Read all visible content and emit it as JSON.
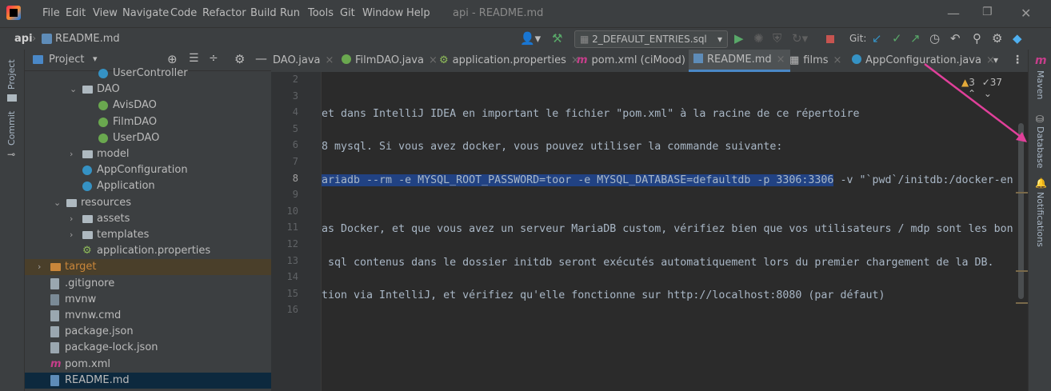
{
  "menu": {
    "items": [
      "File",
      "Edit",
      "View",
      "Navigate",
      "Code",
      "Refactor",
      "Build",
      "Run",
      "Tools",
      "Git",
      "Window",
      "Help"
    ],
    "title": "api - README.md"
  },
  "nav": {
    "project": "api",
    "file": "README.md",
    "run_config": "2_DEFAULT_ENTRIES.sql",
    "git_label": "Git:"
  },
  "project_panel": {
    "title": "Project",
    "tree": [
      {
        "label": "UserController",
        "depth": 4,
        "kind": "class"
      },
      {
        "label": "DAO",
        "depth": 3,
        "kind": "folder",
        "expanded": true
      },
      {
        "label": "AvisDAO",
        "depth": 4,
        "kind": "interface"
      },
      {
        "label": "FilmDAO",
        "depth": 4,
        "kind": "interface"
      },
      {
        "label": "UserDAO",
        "depth": 4,
        "kind": "interface"
      },
      {
        "label": "model",
        "depth": 3,
        "kind": "folder",
        "expanded": false
      },
      {
        "label": "AppConfiguration",
        "depth": 3,
        "kind": "class"
      },
      {
        "label": "Application",
        "depth": 3,
        "kind": "app"
      },
      {
        "label": "resources",
        "depth": 2,
        "kind": "resfolder",
        "expanded": true
      },
      {
        "label": "assets",
        "depth": 3,
        "kind": "folder",
        "expanded": false
      },
      {
        "label": "templates",
        "depth": 3,
        "kind": "folder",
        "expanded": false
      },
      {
        "label": "application.properties",
        "depth": 3,
        "kind": "props"
      },
      {
        "label": "target",
        "depth": 1,
        "kind": "target",
        "expanded": false
      },
      {
        "label": ".gitignore",
        "depth": 1,
        "kind": "file"
      },
      {
        "label": "mvnw",
        "depth": 1,
        "kind": "exec"
      },
      {
        "label": "mvnw.cmd",
        "depth": 1,
        "kind": "file"
      },
      {
        "label": "package.json",
        "depth": 1,
        "kind": "file"
      },
      {
        "label": "package-lock.json",
        "depth": 1,
        "kind": "file"
      },
      {
        "label": "pom.xml",
        "depth": 1,
        "kind": "maven"
      },
      {
        "label": "README.md",
        "depth": 1,
        "kind": "md",
        "selected": true
      }
    ]
  },
  "left_strip": {
    "project": "Project",
    "commit": "Commit"
  },
  "right_strip": {
    "maven": "Maven",
    "database": "Database",
    "notifications": "Notifications"
  },
  "tabs": [
    {
      "label": "DAO.java",
      "icon": ""
    },
    {
      "label": "FilmDAO.java",
      "icon": "interface"
    },
    {
      "label": "application.properties",
      "icon": "props"
    },
    {
      "label": "pom.xml (ciMood)",
      "icon": "maven"
    },
    {
      "label": "README.md",
      "icon": "md",
      "active": true
    },
    {
      "label": "films",
      "icon": "table"
    },
    {
      "label": "AppConfiguration.java",
      "icon": "class"
    }
  ],
  "editor": {
    "warnings": "3",
    "weak_warnings": "37",
    "line_numbers": [
      "2",
      "3",
      "4",
      "5",
      "6",
      "7",
      "8",
      "9",
      "10",
      "11",
      "12",
      "13",
      "14",
      "15",
      "16"
    ],
    "current_line": "8",
    "lines": [
      "",
      "",
      "et dans IntelliJ IDEA en important le fichier \"pom.xml\" à la racine de ce répertoire",
      "",
      "8 mysql. Si vous avez docker, vous pouvez utiliser la commande suivante:",
      "",
      "ariadb --rm -e MYSQL_ROOT_PASSWORD=toor -e MYSQL_DATABASE=defaultdb -p 3306:3306 -v \"`pwd`/initdb:/docker-en",
      "",
      "",
      "as Docker, et que vous avez un serveur MariaDB custom, vérifiez bien que vos utilisateurs / mdp sont les bon",
      "",
      " sql contenus dans le dossier initdb seront exécutés automatiquement lors du premier chargement de la DB. ",
      "",
      "tion via IntelliJ, et vérifiez qu'elle fonctionne sur http://localhost:8080 (par défaut)",
      ""
    ]
  },
  "colors": {
    "bg": "#2b2b2b",
    "panel": "#3c3f41",
    "selection": "#214283",
    "accent": "#e0409a"
  }
}
